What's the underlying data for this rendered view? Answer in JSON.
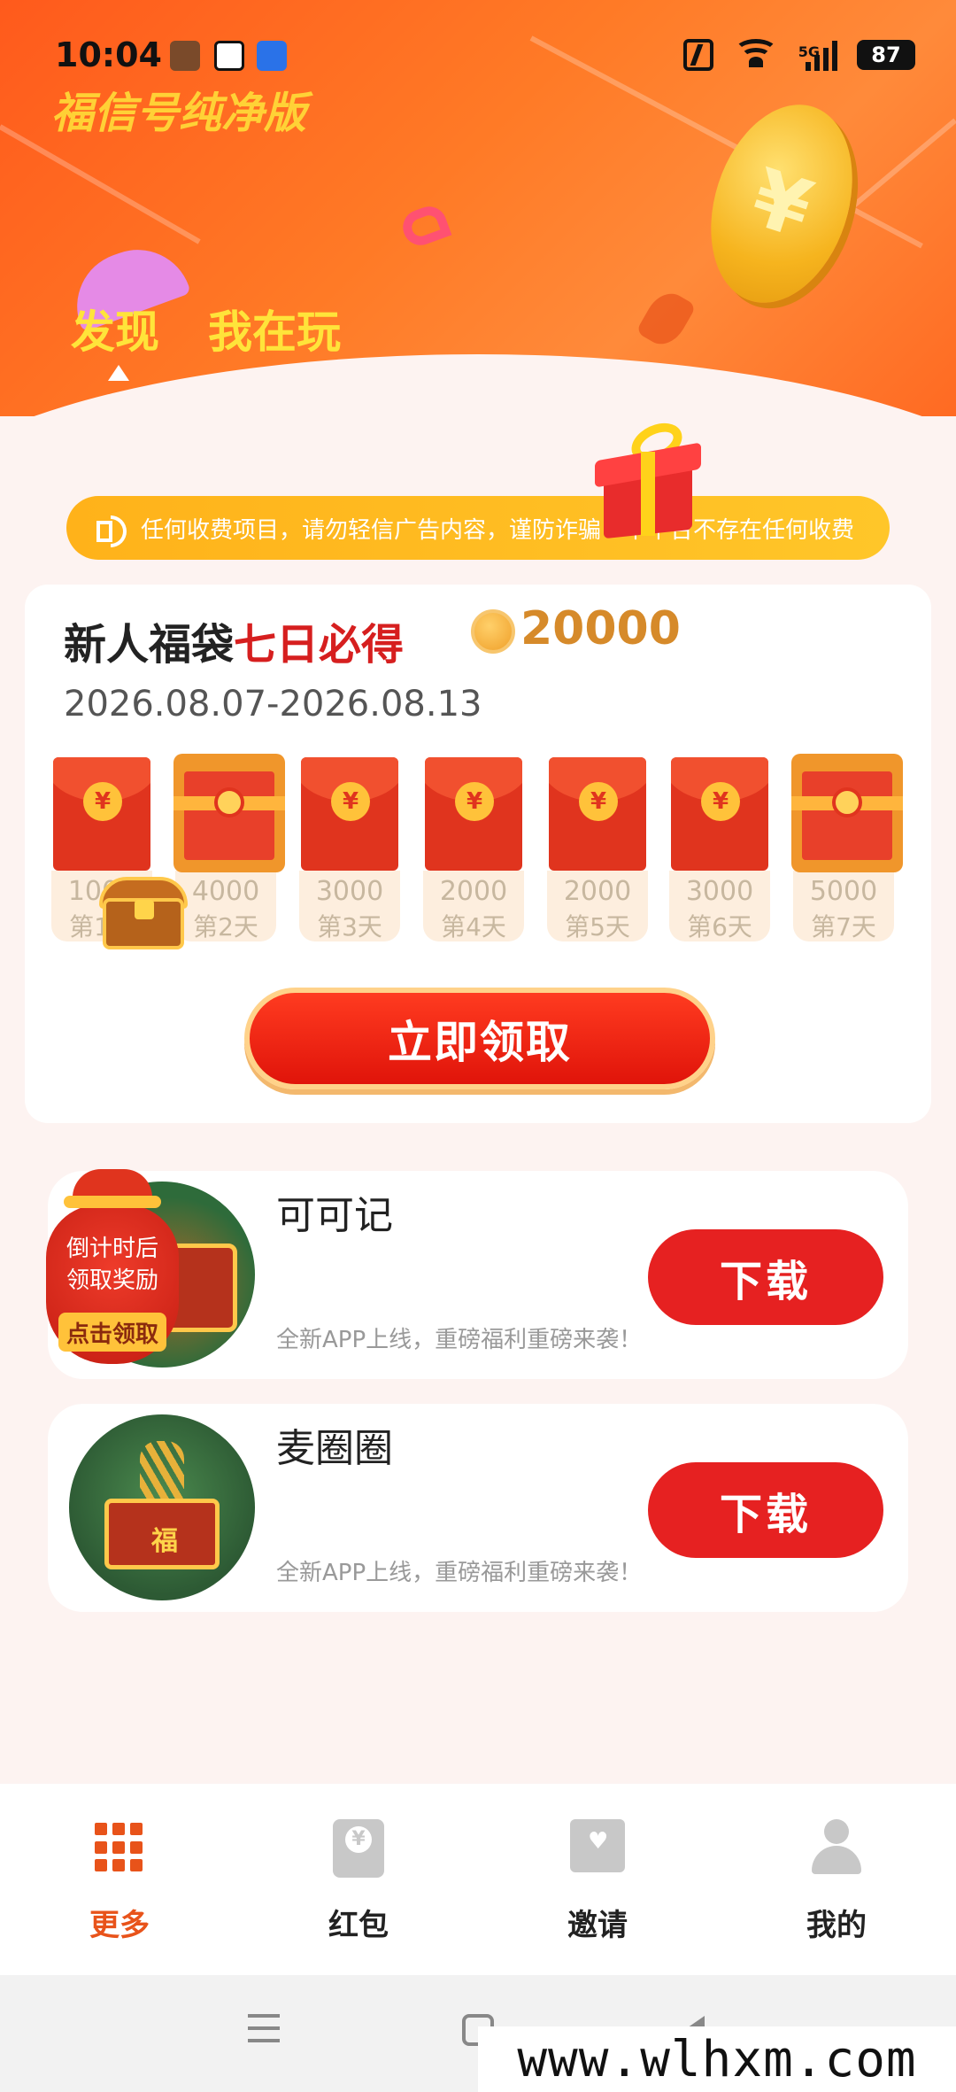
{
  "status_bar": {
    "time": "10:04",
    "network": "5G",
    "battery": "87"
  },
  "header": {
    "app_title": "福信号纯净版",
    "tabs": [
      {
        "label": "发现",
        "active": true
      },
      {
        "label": "我在玩",
        "active": false
      }
    ]
  },
  "notice": {
    "text": "任何收费项目，请勿轻信广告内容，谨防诈骗！本平台不存在任何收费"
  },
  "welfare": {
    "title_part1": "新人福袋",
    "title_part2": "七日必得",
    "coin_amount": "20000",
    "date_range": "2026.08.07-2026.08.13",
    "days": [
      {
        "amount": "1000",
        "label": "第1天",
        "type": "envelope"
      },
      {
        "amount": "4000",
        "label": "第2天",
        "type": "chest"
      },
      {
        "amount": "3000",
        "label": "第3天",
        "type": "envelope"
      },
      {
        "amount": "2000",
        "label": "第4天",
        "type": "envelope"
      },
      {
        "amount": "2000",
        "label": "第5天",
        "type": "envelope"
      },
      {
        "amount": "3000",
        "label": "第6天",
        "type": "envelope"
      },
      {
        "amount": "5000",
        "label": "第7天",
        "type": "chest"
      }
    ],
    "claim_label": "立即领取"
  },
  "countdown_badge": {
    "line1": "倒计时后",
    "line2": "领取奖励",
    "button": "点击领取"
  },
  "apps": [
    {
      "name": "可可记",
      "desc": "全新APP上线，重磅福利重磅来袭！",
      "button": "下载"
    },
    {
      "name": "麦圈圈",
      "desc": "全新APP上线，重磅福利重磅来袭！",
      "button": "下载"
    }
  ],
  "bottom_nav": [
    {
      "label": "更多",
      "icon": "grid-icon",
      "active": true
    },
    {
      "label": "红包",
      "icon": "red-envelope-icon",
      "active": false
    },
    {
      "label": "邀请",
      "icon": "invite-mail-icon",
      "active": false
    },
    {
      "label": "我的",
      "icon": "profile-icon",
      "active": false
    }
  ],
  "watermark": "www.wlhxm.com",
  "colors": {
    "header_orange": "#ff6a22",
    "accent_red": "#e62121",
    "notice_yellow": "#ffb21a",
    "tab_yellow": "#ffe43a",
    "active_nav": "#e8531a"
  }
}
